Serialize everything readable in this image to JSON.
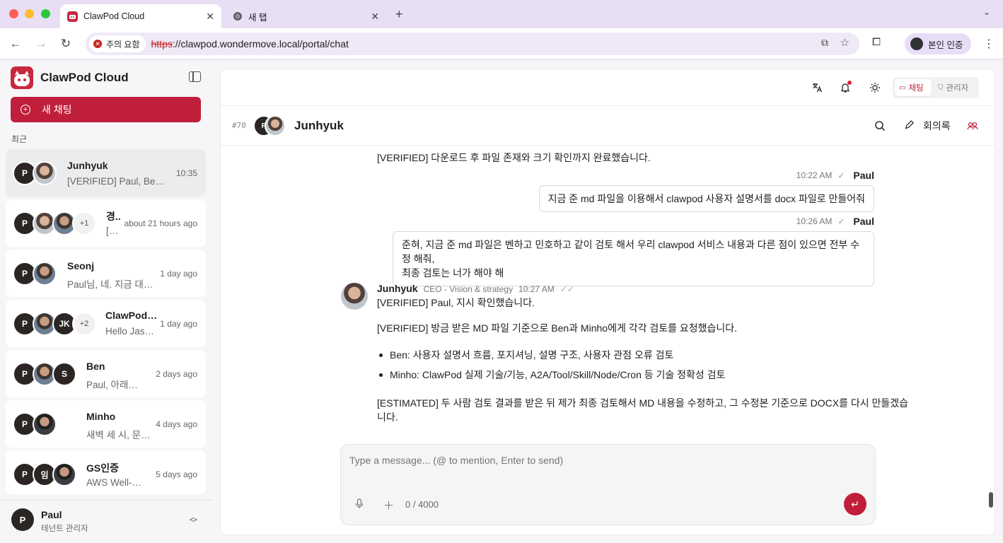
{
  "browser": {
    "tabs": [
      {
        "title": "ClawPod Cloud",
        "active": true
      },
      {
        "title": "새 탭",
        "active": false
      }
    ],
    "security_label": "주의 요함",
    "url_scheme": "https",
    "url_rest": "://clawpod.wondermove.local/portal/chat",
    "profile_label": "본인 인증"
  },
  "sidebar": {
    "brand": "ClawPod Cloud",
    "new_chat_label": "새 채팅",
    "recent_label": "최근",
    "conversations": [
      {
        "name": "Junhyuk",
        "preview": "[VERIFIED] Paul, Ben…",
        "time": "10:35",
        "active": true
      },
      {
        "name": "경..",
        "preview": "[…",
        "time": "about 21 hours ago",
        "extra": "+1"
      },
      {
        "name": "Seonj",
        "preview": "Paul님, 네. 지금 대화…",
        "time": "1 day ago"
      },
      {
        "name": "ClawPod…",
        "preview": "Hello Jas…",
        "time": "1 day ago",
        "extra": "+2",
        "initials": "JK"
      },
      {
        "name": "Ben",
        "preview": "Paul, 아래처…",
        "time": "2 days ago",
        "initials": "S"
      },
      {
        "name": "Minho",
        "preview": "새벽 세 시, 문장들…",
        "time": "4 days ago"
      },
      {
        "name": "GS인증",
        "preview": "AWS Well-A…",
        "time": "5 days ago",
        "initials": "임"
      }
    ],
    "user": {
      "name": "Paul",
      "role": "테넌트 관리자",
      "initial": "P"
    }
  },
  "topbar": {
    "mode_chat": "채팅",
    "mode_admin": "관리자"
  },
  "chat": {
    "room_id": "#70",
    "title": "Junhyuk",
    "meetings_label": "회의록",
    "messages": {
      "m0": "[VERIFIED] 다운로드 후 파일 존재와 크기 확인까지 완료했습니다.",
      "m1_time": "10:22 AM",
      "m1_sender": "Paul",
      "m1_text": "지금 준 md 파일을 이용해서 clawpod 사용자 설명서를 docx 파일로 만들어줘",
      "m2_time": "10:26 AM",
      "m2_sender": "Paul",
      "m2_line1": "준혀, 지금 준  md 파일은 벤하고 민호하고 같이 검토 해서 우리 clawpod 서비스 내용과 다른 점이 있으면 전부 수정 해줘,",
      "m2_line2": "최종 검토는 너가 해야 해",
      "m3_sender": "Junhyuk",
      "m3_role": "CEO - Vision & strategy",
      "m3_time": "10:27 AM",
      "m3_p1": "[VERIFIED] Paul, 지시 확인했습니다.",
      "m3_p2": "[VERIFIED] 방금 받은 MD 파일 기준으로 Ben과 Minho에게 각각 검토를 요청했습니다.",
      "m3_b1": "Ben: 사용자 설명서 흐름, 포지셔닝, 설명 구조, 사용자 관점 오류 검토",
      "m3_b2": "Minho: ClawPod 실제 기술/기능, A2A/Tool/Skill/Node/Cron 등 기술 정확성 검토",
      "m3_p3a": "[ESTIMATED] 두 사람 검토 결과를 받은 뒤 제가 최종 검토해서 MD 내용을 수정하고, 그 수정본 기준으로 DOCX를 다시 만들겠습",
      "m3_p3b": "니다."
    },
    "composer": {
      "placeholder": "Type a message... (@ to mention, Enter to send)",
      "counter": "0 / 4000"
    }
  },
  "colors": {
    "accent": "#c01f3c",
    "warning": "#c5221f"
  }
}
